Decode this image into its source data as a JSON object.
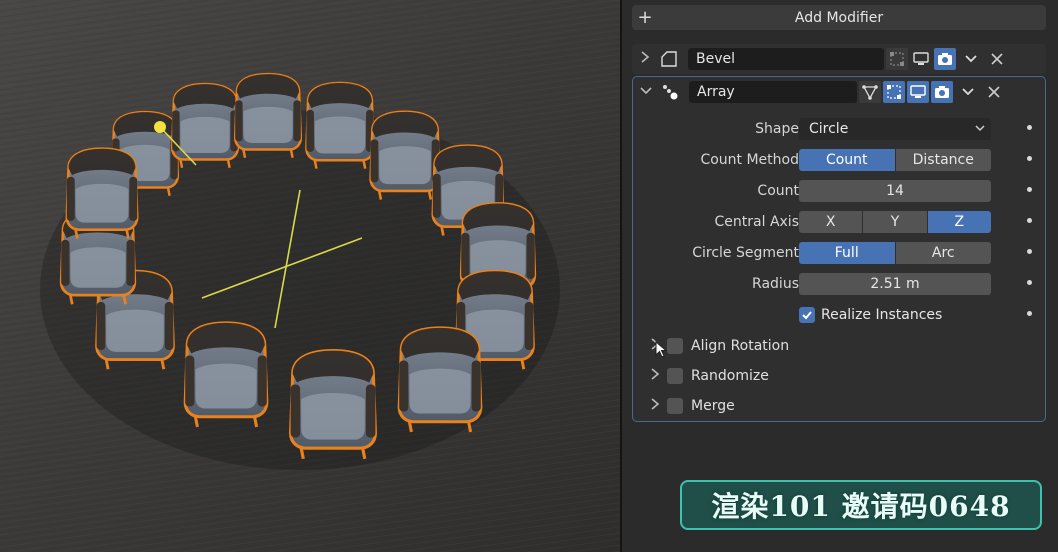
{
  "panel": {
    "add_modifier_label": "Add Modifier",
    "bevel": {
      "name": "Bevel"
    },
    "array": {
      "name": "Array",
      "shape": {
        "label": "Shape",
        "value": "Circle"
      },
      "count_method": {
        "label": "Count Method",
        "options": [
          "Count",
          "Distance"
        ],
        "active": "Count"
      },
      "count": {
        "label": "Count",
        "value": "14"
      },
      "central_axis": {
        "label": "Central Axis",
        "options": [
          "X",
          "Y",
          "Z"
        ],
        "active": "Z"
      },
      "circle_segment": {
        "label": "Circle Segment",
        "options": [
          "Full",
          "Arc"
        ],
        "active": "Full"
      },
      "radius": {
        "label": "Radius",
        "value": "2.51 m"
      },
      "realize_instances": {
        "label": "Realize Instances",
        "checked": true
      },
      "subpanels": [
        {
          "label": "Align Rotation",
          "checked": false
        },
        {
          "label": "Randomize",
          "checked": false
        },
        {
          "label": "Merge",
          "checked": false
        }
      ]
    }
  },
  "watermark": {
    "text": "渲染101 邀请码0648"
  },
  "colors": {
    "accent": "#4772b3",
    "selection_outline": "#e8821e",
    "panel_bg": "#2b2b2b",
    "watermark_border": "#3fc2b0"
  },
  "icons": [
    "plus-icon",
    "chevron-right-icon",
    "chevron-down-icon",
    "bevel-modifier-icon",
    "array-modifier-icon",
    "vertex-group-icon",
    "edit-mode-icon",
    "monitor-icon",
    "camera-icon",
    "close-icon",
    "checkmark-icon",
    "cursor-icon"
  ]
}
